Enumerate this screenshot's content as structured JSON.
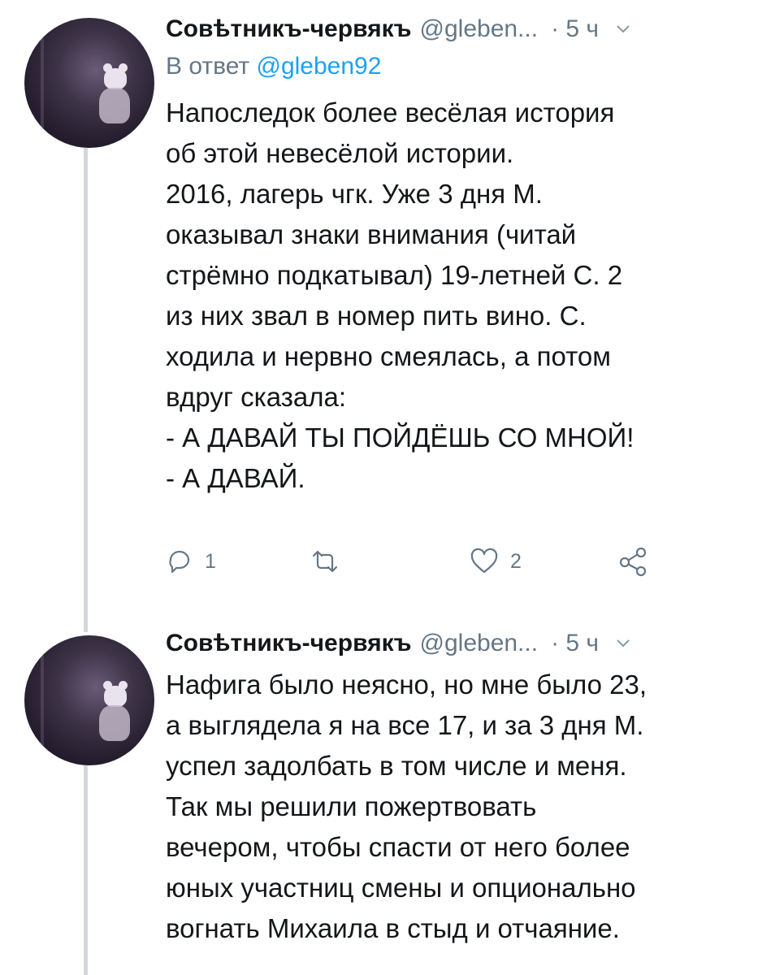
{
  "tweets": [
    {
      "author_name": "Совѣтникъ-червякъ",
      "handle": "@gleben...",
      "time": "· 5 ч",
      "reply_prefix": "В ответ",
      "reply_mention": "@gleben92",
      "text": "Напоследок более весёлая история\nоб этой невесёлой истории.\n2016, лагерь чгк. Уже 3 дня М.\nоказывал знаки внимания (читай\nстрёмно подкатывал) 19-летней С. 2\nиз них звал в номер пить вино. С.\nходила и нервно смеялась, а потом\nвдруг сказала:\n- А ДАВАЙ ТЫ ПОЙДЁШЬ СО МНОЙ!\n- А ДАВАЙ.",
      "reply_count": "1",
      "like_count": "2",
      "icons": [
        "reply-icon",
        "retweet-icon",
        "like-icon",
        "share-icon",
        "chevron-down-icon"
      ]
    },
    {
      "author_name": "Совѣтникъ-червякъ",
      "handle": "@gleben...",
      "time": "· 5 ч",
      "text": "Нафига было неясно, но мне было 23,\nа выглядела я на все 17, и за 3 дня М.\nуспел задолбать в том числе и меня.\nТак мы решили пожертвовать\nвечером, чтобы спасти от него более\nюных участниц смены и опционально\nвогнать Михаила в стыд и отчаяние.",
      "icons": [
        "chevron-down-icon"
      ]
    }
  ],
  "colors": {
    "text": "#14171a",
    "secondary": "#657786",
    "link": "#1da1f2",
    "thread_line": "#d2d8dd"
  }
}
